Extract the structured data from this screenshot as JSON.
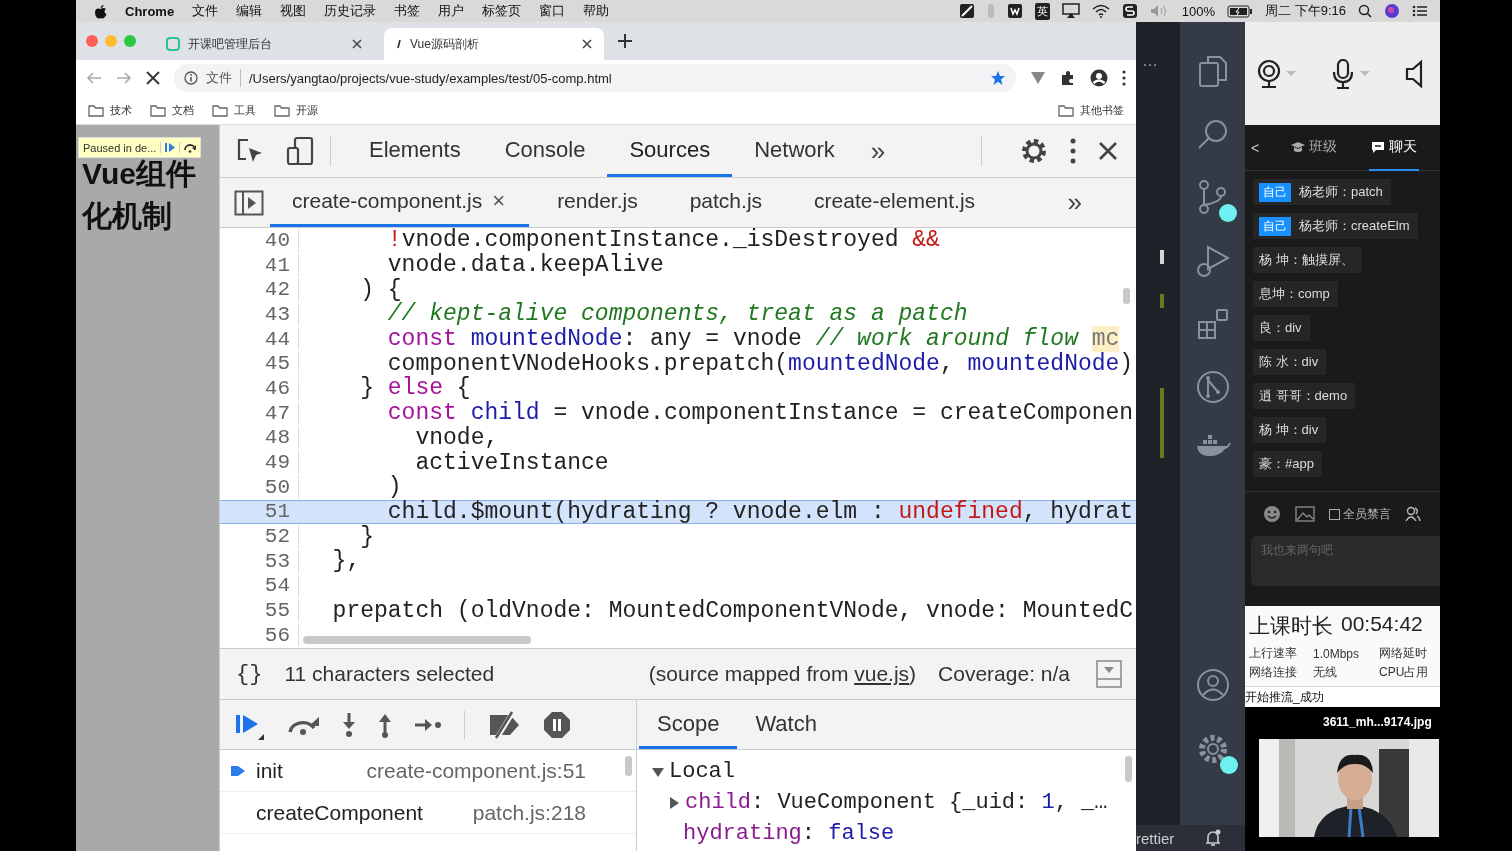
{
  "menu_bar": {
    "app": "Chrome",
    "menus": [
      "文件",
      "编辑",
      "视图",
      "历史记录",
      "书签",
      "用户",
      "标签页",
      "窗口",
      "帮助"
    ],
    "input_method": "英",
    "battery": "100%",
    "clock": "周二 下午9:16"
  },
  "browser": {
    "tabs": [
      {
        "title": "开课吧管理后台",
        "selected": false
      },
      {
        "title": "Vue源码剖析",
        "selected": true
      }
    ],
    "address": {
      "scheme": "文件",
      "url": "/Users/yangtao/projects/vue-study/examples/test/05-comp.html"
    },
    "bookmarks": [
      "技术",
      "文档",
      "工具",
      "开源"
    ],
    "other_bookmarks": "其他书签"
  },
  "page": {
    "paused_label": "Paused in de...",
    "heading": "Vue组件化机制"
  },
  "devtools": {
    "panels": [
      {
        "label": "Elements",
        "selected": false
      },
      {
        "label": "Console",
        "selected": false
      },
      {
        "label": "Sources",
        "selected": true
      },
      {
        "label": "Network",
        "selected": false
      }
    ],
    "panels_more": "»",
    "files": [
      {
        "name": "create-component.js",
        "selected": true
      },
      {
        "name": "render.js",
        "selected": false
      },
      {
        "name": "patch.js",
        "selected": false
      },
      {
        "name": "create-element.js",
        "selected": false
      }
    ],
    "files_more": "»",
    "file_close": "×",
    "code": {
      "lines": [
        {
          "number": "40",
          "selected": false,
          "tokens": [
            {
              "kind": "op",
              "text": "      !"
            },
            {
              "kind": "plain",
              "text": "vnode.componentInstance._isDestroyed "
            },
            {
              "kind": "op",
              "text": "&&"
            }
          ]
        },
        {
          "number": "41",
          "selected": false,
          "tokens": [
            {
              "kind": "plain",
              "text": "      vnode.data.keepAlive"
            }
          ]
        },
        {
          "number": "42",
          "selected": false,
          "tokens": [
            {
              "kind": "plain",
              "text": "    ) {"
            }
          ]
        },
        {
          "number": "43",
          "selected": false,
          "tokens": [
            {
              "kind": "comment",
              "text": "      // kept-alive components, treat as a patch"
            }
          ]
        },
        {
          "number": "44",
          "selected": false,
          "tokens": [
            {
              "kind": "keyword",
              "text": "      const"
            },
            {
              "kind": "ident",
              "text": " mountedNode"
            },
            {
              "kind": "plain",
              "text": ": any = vnode "
            },
            {
              "kind": "comment",
              "text": "// work around flow "
            },
            {
              "kind": "hint",
              "text": "mc"
            }
          ]
        },
        {
          "number": "45",
          "selected": false,
          "tokens": [
            {
              "kind": "plain",
              "text": "      componentVNodeHooks.prepatch("
            },
            {
              "kind": "ident",
              "text": "mountedNode"
            },
            {
              "kind": "plain",
              "text": ", "
            },
            {
              "kind": "ident",
              "text": "mountedNode"
            },
            {
              "kind": "plain",
              "text": ")"
            }
          ]
        },
        {
          "number": "46",
          "selected": false,
          "tokens": [
            {
              "kind": "plain",
              "text": "    } "
            },
            {
              "kind": "keyword",
              "text": "else"
            },
            {
              "kind": "plain",
              "text": " {"
            }
          ]
        },
        {
          "number": "47",
          "selected": false,
          "tokens": [
            {
              "kind": "keyword",
              "text": "      const"
            },
            {
              "kind": "ident",
              "text": " child"
            },
            {
              "kind": "plain",
              "text": " = vnode.componentInstance = createComponen"
            }
          ]
        },
        {
          "number": "48",
          "selected": false,
          "tokens": [
            {
              "kind": "plain",
              "text": "        vnode,"
            }
          ]
        },
        {
          "number": "49",
          "selected": false,
          "tokens": [
            {
              "kind": "plain",
              "text": "        activeInstance"
            }
          ]
        },
        {
          "number": "50",
          "selected": false,
          "tokens": [
            {
              "kind": "plain",
              "text": "      )"
            }
          ]
        },
        {
          "number": "51",
          "selected": true,
          "tokens": [
            {
              "kind": "plain",
              "text": "      child.$mount(hydrating ? vnode.elm : "
            },
            {
              "kind": "op",
              "text": "undefined"
            },
            {
              "kind": "plain",
              "text": ", hydrat"
            }
          ]
        },
        {
          "number": "52",
          "selected": false,
          "tokens": [
            {
              "kind": "plain",
              "text": "    }"
            }
          ]
        },
        {
          "number": "53",
          "selected": false,
          "tokens": [
            {
              "kind": "plain",
              "text": "  },"
            }
          ]
        },
        {
          "number": "54",
          "selected": false
        },
        {
          "number": "55",
          "selected": false,
          "tokens": [
            {
              "kind": "plain",
              "text": "  prepatch (oldVnode: MountedComponentVNode, vnode: MountedC"
            }
          ]
        },
        {
          "number": "56",
          "selected": false
        }
      ]
    },
    "status": {
      "format": "{}",
      "selection": "11 characters selected",
      "source_prefix": "(source mapped from",
      "source_link": "vue.js",
      "source_suffix": ")",
      "coverage": "Coverage: n/a"
    },
    "call_stack": [
      {
        "function": "init",
        "location": "create-component.js:51",
        "selected": true
      },
      {
        "function": "createComponent",
        "location": "patch.js:218",
        "selected": false
      }
    ],
    "sidebar_tabs": [
      {
        "label": "Scope",
        "selected": true
      },
      {
        "label": "Watch",
        "selected": false
      }
    ],
    "scope": {
      "section": "Local",
      "expanded": true,
      "vars": [
        {
          "kind": "object",
          "name": "child",
          "value": [
            {
              "kind": "plain",
              "text": ": VueComponent {_uid: "
            },
            {
              "kind": "number",
              "text": "1"
            },
            {
              "kind": "plain",
              "text": ", _…"
            }
          ]
        },
        {
          "kind": "primitive",
          "name": "hydrating",
          "value": [
            {
              "kind": "plain",
              "text": ": "
            },
            {
              "kind": "literal",
              "text": "false"
            }
          ]
        }
      ]
    }
  },
  "editor": {
    "ellipsis": "…",
    "status_text": "rettier"
  },
  "chat": {
    "back": "<",
    "tabs": [
      {
        "label": "班级",
        "selected": false
      },
      {
        "label": "聊天",
        "selected": true
      }
    ],
    "messages": [
      {
        "badge": "自己",
        "text": "杨老师：patch"
      },
      {
        "badge": "自己",
        "text": "杨老师：createElm"
      },
      {
        "text": "杨 坤：触摸屏、"
      },
      {
        "text": "息坤：comp"
      },
      {
        "text": "良：div"
      },
      {
        "text": "陈 水：div"
      },
      {
        "text": "逍 哥哥：demo"
      },
      {
        "text": "杨 坤：div"
      },
      {
        "text": "豪：#app"
      }
    ],
    "mute_all": {
      "label": "全员禁言",
      "checked": false
    },
    "placeholder": "我也来两句吧",
    "stats": {
      "duration_label": "上课时长",
      "duration": "00:54:42",
      "rows": [
        [
          "上行速率",
          "1.0Mbps",
          "网络延时"
        ],
        [
          "网络连接",
          "无线",
          "CPU占用"
        ]
      ]
    },
    "log": "开始推流_成功",
    "video": {
      "caption": "3611_mh...9174.jpg",
      "kind": "picture"
    }
  }
}
